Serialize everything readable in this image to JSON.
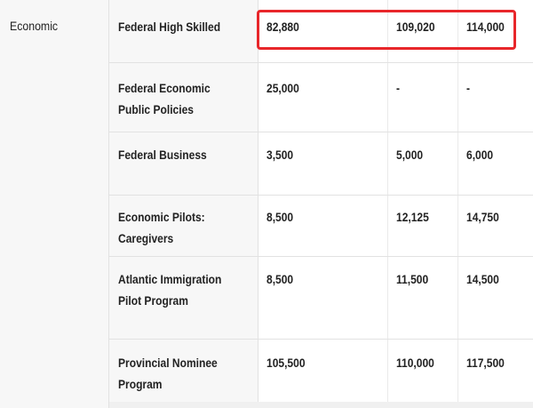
{
  "table": {
    "category": "Economic",
    "rows": [
      {
        "program": "Federal High Skilled",
        "v1": "82,880",
        "v2": "109,020",
        "v3": "114,000"
      },
      {
        "program": "Federal Economic Public Policies",
        "v1": "25,000",
        "v2": "-",
        "v3": "-"
      },
      {
        "program": "Federal Business",
        "v1": "3,500",
        "v2": "5,000",
        "v3": "6,000"
      },
      {
        "program": "Economic Pilots: Caregivers",
        "v1": "8,500",
        "v2": "12,125",
        "v3": "14,750"
      },
      {
        "program": "Atlantic Immigration Pilot Program",
        "v1": "8,500",
        "v2": "11,500",
        "v3": "14,500"
      },
      {
        "program": "Provincial Nominee Program",
        "v1": "105,500",
        "v2": "110,000",
        "v3": "117,500"
      }
    ]
  },
  "highlight": {
    "color": "#e8262a",
    "target_row": "Federal High Skilled"
  }
}
